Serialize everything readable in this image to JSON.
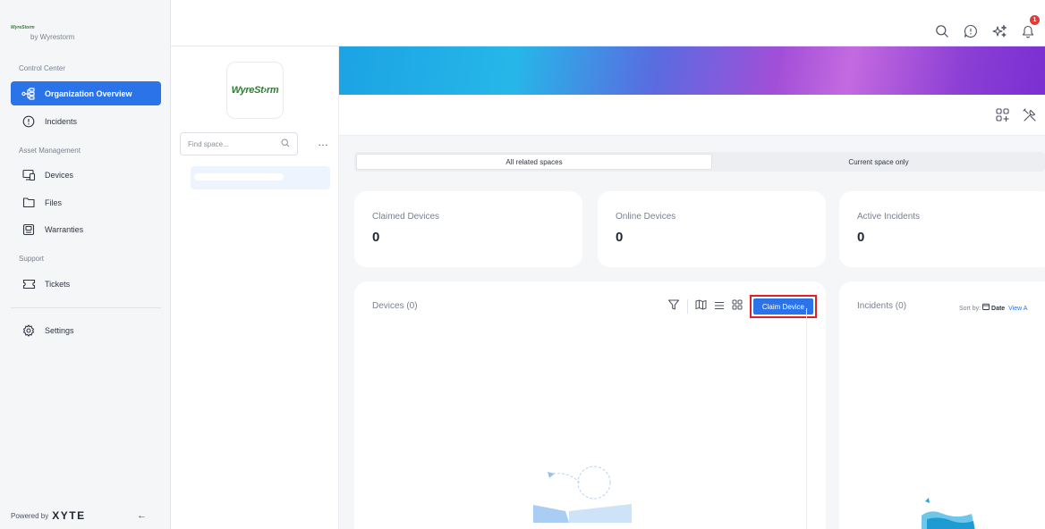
{
  "brand": {
    "logo_text": "WyreStorm",
    "subtitle": "by Wyrestorm"
  },
  "sidebar": {
    "sections": {
      "control_center": "Control Center",
      "asset_management": "Asset Management",
      "support": "Support"
    },
    "items": [
      {
        "label": "Organization Overview",
        "icon": "org-tree-icon",
        "active": true
      },
      {
        "label": "Incidents",
        "icon": "alert-circle-icon"
      },
      {
        "label": "Devices",
        "icon": "devices-icon"
      },
      {
        "label": "Files",
        "icon": "folder-icon"
      },
      {
        "label": "Warranties",
        "icon": "warranty-icon"
      },
      {
        "label": "Tickets",
        "icon": "ticket-icon"
      },
      {
        "label": "Settings",
        "icon": "gear-icon"
      }
    ],
    "footer": {
      "powered_by": "Powered by",
      "xyte": "XYTE",
      "collapse_glyph": "←"
    }
  },
  "topbar": {
    "notification_count": "1"
  },
  "spaces": {
    "logo_text": "WyreSt›rm",
    "find_placeholder": "Find space...",
    "more_glyph": "…"
  },
  "scope_toggle": {
    "all": "All related spaces",
    "current": "Current space only"
  },
  "stats": [
    {
      "label": "Claimed Devices",
      "value": "0"
    },
    {
      "label": "Online Devices",
      "value": "0"
    },
    {
      "label": "Active Incidents",
      "value": "0"
    }
  ],
  "devices_panel": {
    "title": "Devices (0)",
    "claim_label": "Claim Device"
  },
  "incidents_panel": {
    "title": "Incidents (0)",
    "sort_label": "Sort by:",
    "sort_value": "Date",
    "view_all": "View A"
  },
  "colors": {
    "accent": "#2a73e8",
    "highlight": "#e31e24",
    "brand_green": "#2e7d32",
    "badge": "#e53935"
  }
}
